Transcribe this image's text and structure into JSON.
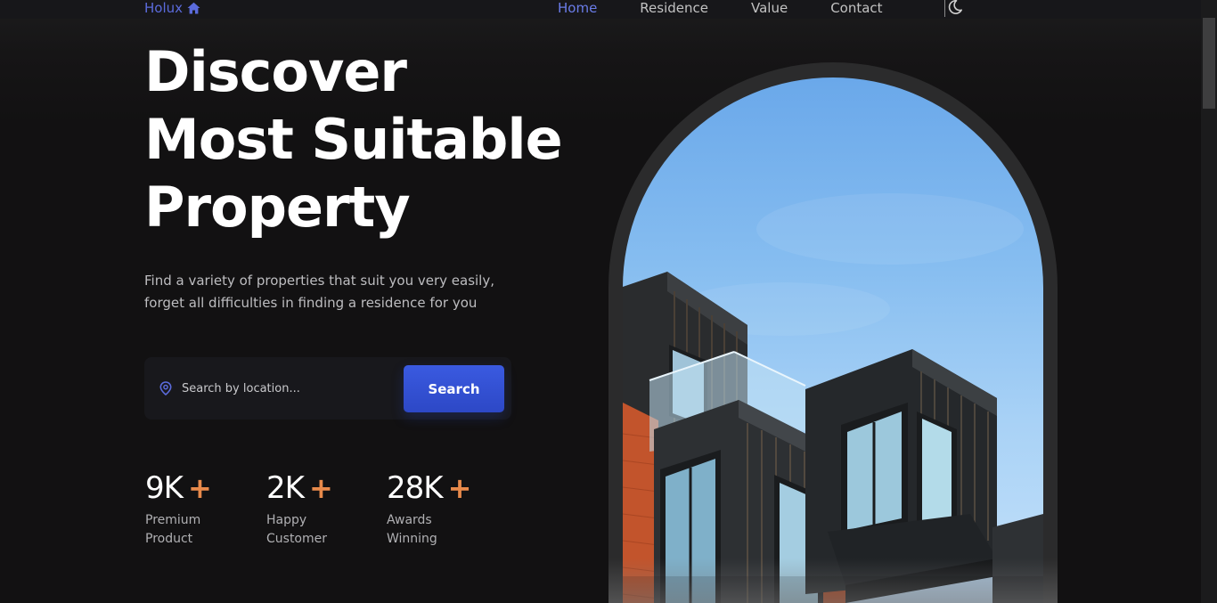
{
  "header": {
    "logo_text": "Holux",
    "logo_icon": "home-icon",
    "nav": [
      {
        "label": "Home",
        "active": true
      },
      {
        "label": "Residence",
        "active": false
      },
      {
        "label": "Value",
        "active": false
      },
      {
        "label": "Contact",
        "active": false
      }
    ],
    "theme_icon": "moon-icon"
  },
  "hero": {
    "title_lines": [
      "Discover",
      "Most Suitable",
      "Property"
    ],
    "description_lines": [
      "Find a variety of properties that suit you very easily,",
      "forget all difficulties in finding a residence for you"
    ]
  },
  "search": {
    "icon": "location-pin-icon",
    "placeholder": "Search by location...",
    "button_label": "Search"
  },
  "stats": [
    {
      "number": "9K",
      "plus": "+",
      "label_lines": [
        "Premium",
        "Product"
      ]
    },
    {
      "number": "2K",
      "plus": "+",
      "label_lines": [
        "Happy",
        "Customer"
      ]
    },
    {
      "number": "28K",
      "plus": "+",
      "label_lines": [
        "Awards",
        "Winning"
      ]
    }
  ],
  "colors": {
    "accent": "#5b6bdc",
    "button": "#3050d8",
    "plus": "#e88a4b",
    "background": "#121112"
  }
}
